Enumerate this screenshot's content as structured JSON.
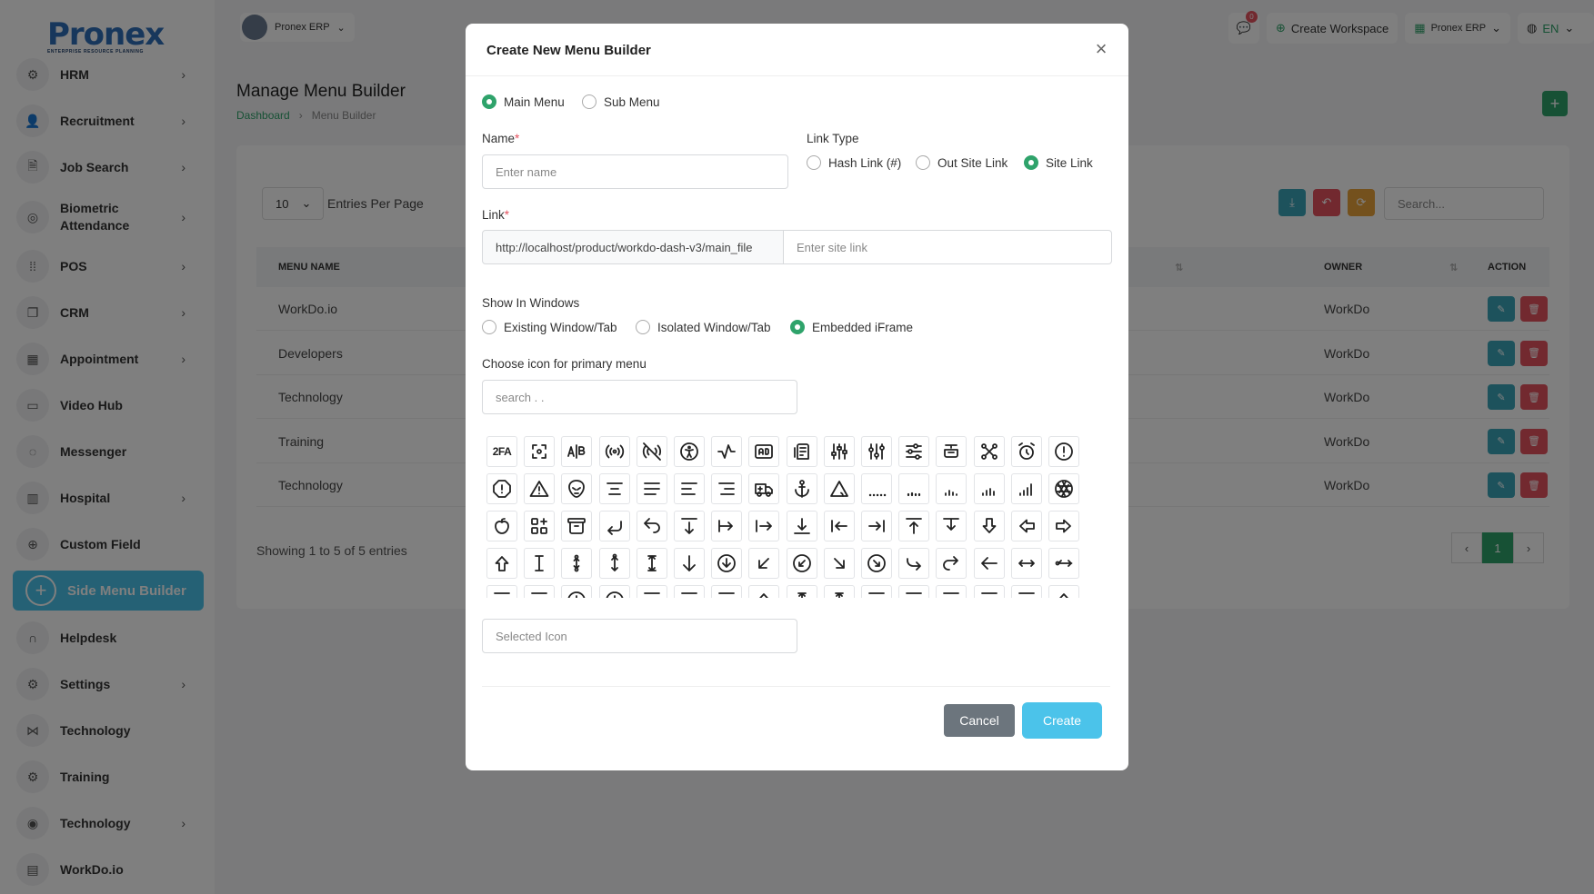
{
  "brand": {
    "logo_text": "Pronex",
    "logo_sub": "ENTERPRISE RESOURCE PLANNING"
  },
  "sidebar": {
    "items": [
      {
        "label": "HRM",
        "icon": "gear-people-icon",
        "chevron": true
      },
      {
        "label": "Recruitment",
        "icon": "user-plus-icon",
        "chevron": true
      },
      {
        "label": "Job Search",
        "icon": "document-search-icon",
        "chevron": true
      },
      {
        "label": "Biometric Attendance",
        "icon": "fingerprint-icon",
        "chevron": true
      },
      {
        "label": "POS",
        "icon": "grid-dots-icon",
        "chevron": true
      },
      {
        "label": "CRM",
        "icon": "layers-icon",
        "chevron": true
      },
      {
        "label": "Appointment",
        "icon": "calendar-icon",
        "chevron": true
      },
      {
        "label": "Video Hub",
        "icon": "video-icon",
        "chevron": false
      },
      {
        "label": "Messenger",
        "icon": "chat-icon",
        "chevron": false
      },
      {
        "label": "Hospital",
        "icon": "building-icon",
        "chevron": true
      },
      {
        "label": "Custom Field",
        "icon": "plus-circle-icon",
        "chevron": false
      },
      {
        "label": "Side Menu Builder",
        "icon": "plus-circle-icon",
        "chevron": false,
        "active": true
      },
      {
        "label": "Helpdesk",
        "icon": "headset-icon",
        "chevron": false
      },
      {
        "label": "Settings",
        "icon": "settings-icon",
        "chevron": true
      },
      {
        "label": "Technology",
        "icon": "share-icon",
        "chevron": false
      },
      {
        "label": "Training",
        "icon": "gear-people-icon",
        "chevron": false
      },
      {
        "label": "Technology",
        "icon": "broadcast-icon",
        "chevron": true
      },
      {
        "label": "WorkDo.io",
        "icon": "report-icon",
        "chevron": false
      }
    ]
  },
  "topbar": {
    "workspace": "Pronex ERP",
    "notifications": "0",
    "create_workspace": "Create Workspace",
    "company": "Pronex ERP",
    "language": "EN"
  },
  "page": {
    "title": "Manage Menu Builder",
    "crumb_home": "Dashboard",
    "crumb_current": "Menu Builder",
    "per_page": "10",
    "per_page_label": "Entries Per Page",
    "search_placeholder": "Search...",
    "columns": [
      "MENU NAME",
      "OWNER",
      "ACTION"
    ],
    "rows": [
      {
        "name": "WorkDo.io",
        "owner": "WorkDo"
      },
      {
        "name": "Developers",
        "owner": "WorkDo"
      },
      {
        "name": "Technology",
        "owner": "WorkDo"
      },
      {
        "name": "Training",
        "owner": "WorkDo"
      },
      {
        "name": "Technology",
        "owner": "WorkDo"
      }
    ],
    "showing": "Showing 1 to 5 of 5 entries",
    "page_number": "1"
  },
  "colors": {
    "primary": "#2fa36b",
    "accent": "#4bc3ea",
    "danger": "#e4525f",
    "edit": "#3aa5b9",
    "warning": "#e9a23b"
  },
  "modal": {
    "title": "Create New Menu Builder",
    "menu_type": {
      "main": "Main Menu",
      "sub": "Sub Menu",
      "selected": "main"
    },
    "name_label": "Name",
    "name_placeholder": "Enter name",
    "link_type_label": "Link Type",
    "link_types": {
      "hash": "Hash Link (#)",
      "out": "Out Site Link",
      "site": "Site Link",
      "selected": "site"
    },
    "link_label": "Link",
    "link_prefix": "http://localhost/product/workdo-dash-v3/main_file",
    "link_placeholder": "Enter site link",
    "show_in_windows_label": "Show In Windows",
    "windows": {
      "existing": "Existing Window/Tab",
      "isolated": "Isolated Window/Tab",
      "embedded": "Embedded iFrame",
      "selected": "embedded"
    },
    "icon_label": "Choose icon for primary menu",
    "icon_search_placeholder": "search . .",
    "icon_2fa": "2FA",
    "selected_icon_placeholder": "Selected Icon",
    "cancel": "Cancel",
    "create": "Create"
  }
}
